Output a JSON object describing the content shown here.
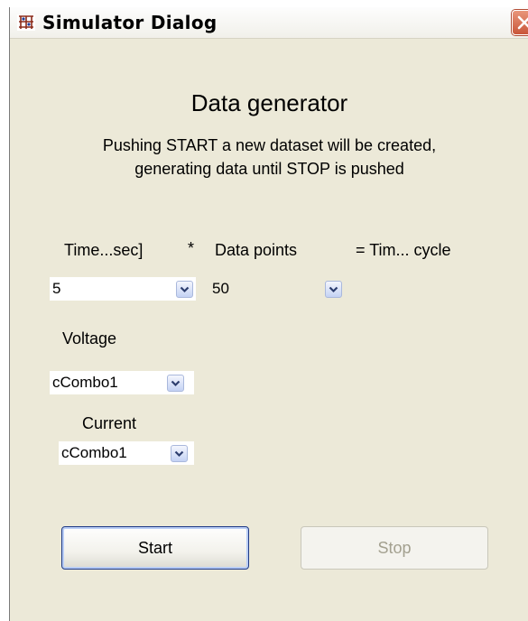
{
  "window": {
    "title": "Simulator Dialog",
    "close_icon": "close-icon",
    "app_icon": "simulator-app-icon"
  },
  "heading": "Data generator",
  "description": {
    "line1": "Pushing START a new dataset will be created,",
    "line2": "generating data until STOP is pushed"
  },
  "labels": {
    "time": "Time...sec]",
    "multiply": "*",
    "data_points": "Data points",
    "equals_time_cycle": "= Tim... cycle",
    "voltage": "Voltage",
    "current": "Current"
  },
  "combos": {
    "time": {
      "value": "5"
    },
    "data_points": {
      "value": "50",
      "disabled": true
    },
    "voltage": {
      "value": "cCombo1"
    },
    "current": {
      "value": "cCombo1"
    }
  },
  "buttons": {
    "start": "Start",
    "stop": "Stop",
    "stop_disabled": true
  },
  "colors": {
    "dialog_bg": "#ece9d8",
    "close_button": "#d0593b",
    "start_border": "#1f3a85",
    "disabled_text": "#a3a08f"
  }
}
